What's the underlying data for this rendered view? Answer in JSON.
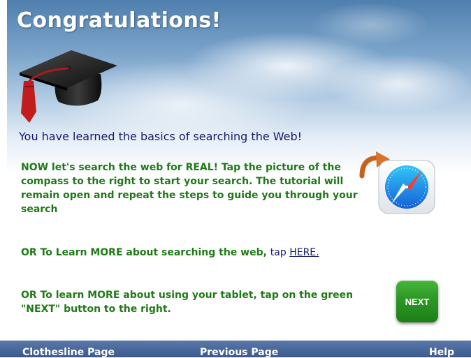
{
  "page": {
    "title": "Congratulations!",
    "subtitle": "You have learned the basics of searching the Web!"
  },
  "content": {
    "paragraph1": "NOW let's search the web for REAL! Tap the picture of the compass to the right  to start your search. The tutorial will remain open and repeat the steps to guide you through your search",
    "paragraph2_lead": "OR To Learn MORE about searching the web, ",
    "paragraph2_tap": "tap ",
    "paragraph2_link": "HERE.",
    "paragraph3": "OR To learn MORE about using your tablet, tap on the green \"NEXT\" button to the right."
  },
  "icons": {
    "cap": "graduation-cap-icon",
    "arrow": "curved-arrow-icon",
    "compass": "safari-compass-icon"
  },
  "buttons": {
    "next": "NEXT"
  },
  "footer": {
    "left": "Clothesline Page",
    "center": "Previous Page",
    "right": "Help"
  },
  "colors": {
    "title_text": "#ffffff",
    "subtitle_text": "#151a6b",
    "body_green": "#1f7a16",
    "link_navy": "#151a6b",
    "next_button": "#2c9724",
    "footer_bar": "#3b5a8e"
  }
}
